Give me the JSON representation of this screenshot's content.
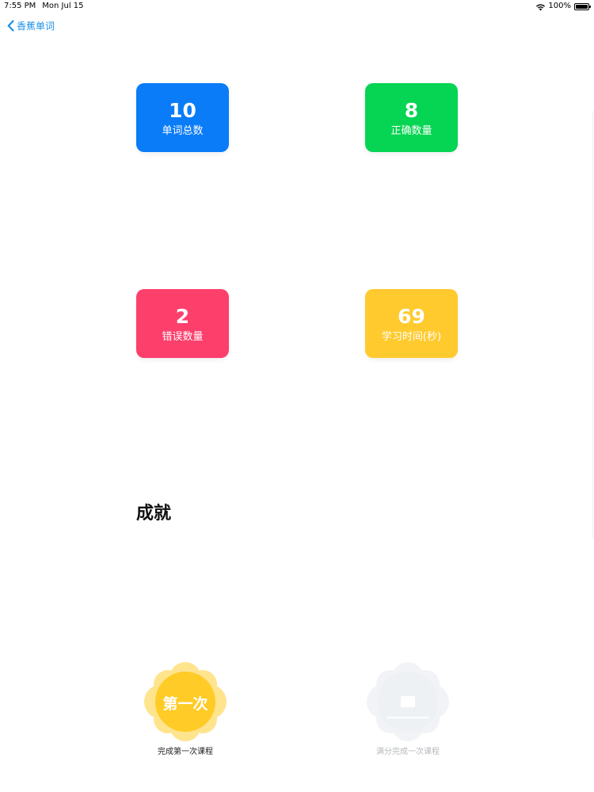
{
  "status_bar": {
    "time": "7:55 PM",
    "date": "Mon Jul 15",
    "battery": "100%"
  },
  "nav": {
    "back_label": "香蕉单词"
  },
  "stats": [
    {
      "value": "10",
      "label": "单词总数",
      "color": "#0a7cf8"
    },
    {
      "value": "8",
      "label": "正确数量",
      "color": "#05d552"
    },
    {
      "value": "2",
      "label": "错误数量",
      "color": "#fd3f6c"
    },
    {
      "value": "69",
      "label": "学习时间(秒)",
      "color": "#ffca2e"
    }
  ],
  "achievements": {
    "title": "成就",
    "badges": [
      {
        "text": "第一次",
        "caption": "完成第一次课程",
        "unlocked": true,
        "caption_color": "#222222"
      },
      {
        "text": "",
        "caption": "满分完成一次课程",
        "unlocked": false,
        "caption_color": "#b5b9bd"
      }
    ]
  },
  "colors": {
    "accent": "#1a8fe8",
    "badge_gold": "#ffcf33",
    "badge_locked": "#eef1f4"
  }
}
